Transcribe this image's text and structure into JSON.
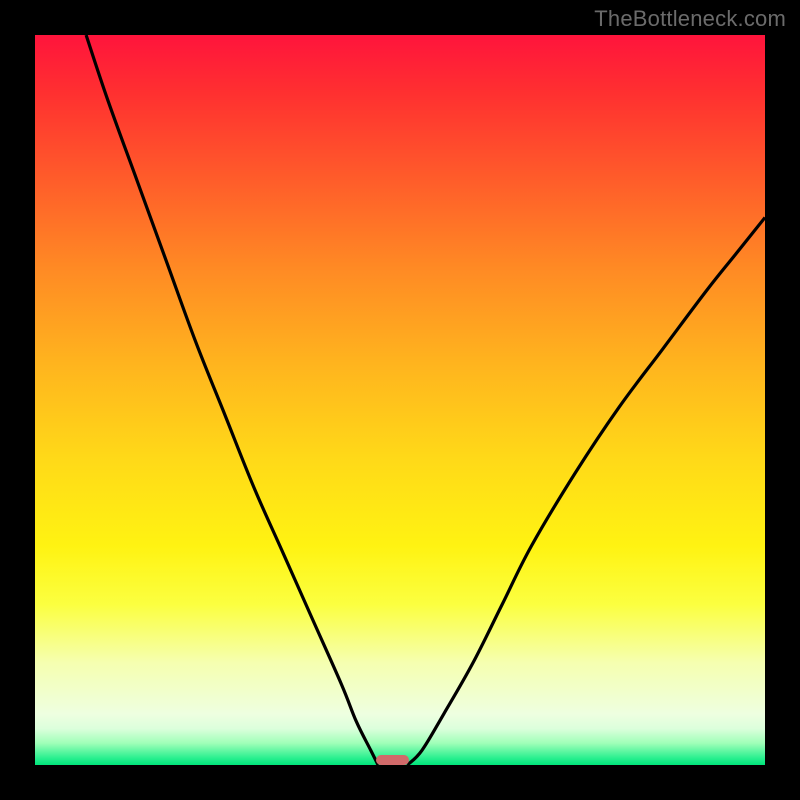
{
  "watermark": "TheBottleneck.com",
  "chart_data": {
    "type": "line",
    "title": "",
    "xlabel": "",
    "ylabel": "",
    "xlim": [
      0,
      100
    ],
    "ylim": [
      0,
      100
    ],
    "grid": false,
    "series": [
      {
        "name": "left-branch",
        "x": [
          7,
          10,
          14,
          18,
          22,
          26,
          30,
          34,
          38,
          42,
          44,
          46,
          47
        ],
        "values": [
          100,
          91,
          80,
          69,
          58,
          48,
          38,
          29,
          20,
          11,
          6,
          2,
          0
        ]
      },
      {
        "name": "right-branch",
        "x": [
          51,
          53,
          56,
          60,
          64,
          68,
          74,
          80,
          86,
          92,
          96,
          100
        ],
        "values": [
          0,
          2,
          7,
          14,
          22,
          30,
          40,
          49,
          57,
          65,
          70,
          75
        ]
      }
    ],
    "annotations": [
      {
        "name": "min-marker",
        "x": 49,
        "y": 0,
        "width_pct": 4.5,
        "height_pct": 1.4,
        "color": "#d16a6a"
      }
    ],
    "background": {
      "type": "vertical-gradient",
      "top_color": "#ff143c",
      "mid_color": "#ffd918",
      "bottom_color": "#00e47a"
    }
  }
}
